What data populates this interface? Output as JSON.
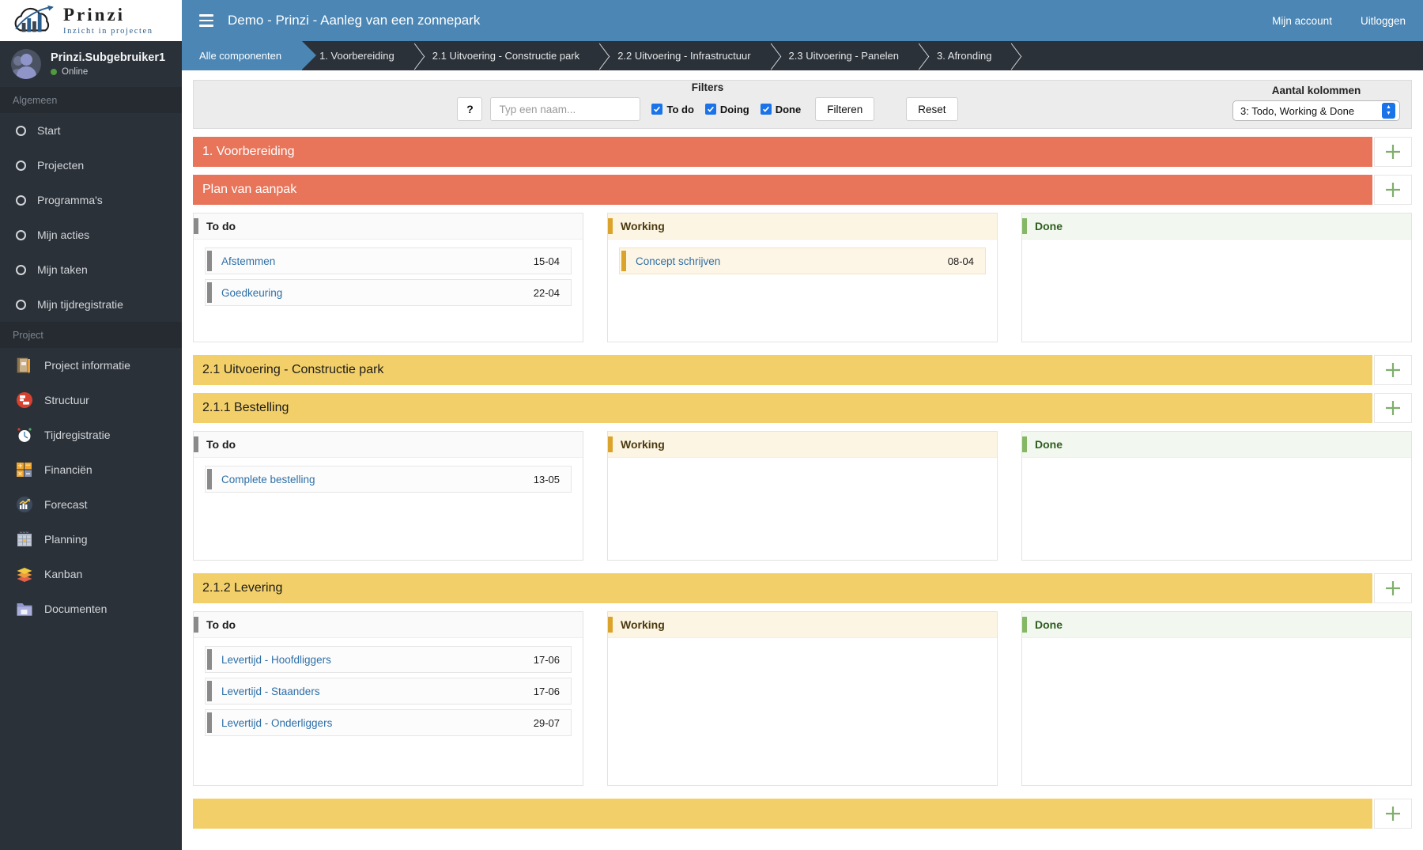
{
  "brand": {
    "title": "Prinzi",
    "subtitle": "Inzicht in projecten",
    "logo_icon": "cloud-chart-logo"
  },
  "user": {
    "name": "Prinzi.Subgebruiker1",
    "status": "Online",
    "avatar_icon": "users-avatar"
  },
  "sidebar": {
    "groups": [
      {
        "label": "Algemeen",
        "items": [
          {
            "label": "Start",
            "icon": "circle-icon"
          },
          {
            "label": "Projecten",
            "icon": "circle-icon"
          },
          {
            "label": "Programma's",
            "icon": "circle-icon"
          },
          {
            "label": "Mijn acties",
            "icon": "circle-icon"
          },
          {
            "label": "Mijn taken",
            "icon": "circle-icon"
          },
          {
            "label": "Mijn tijdregistratie",
            "icon": "circle-icon"
          }
        ]
      },
      {
        "label": "Project",
        "items": [
          {
            "label": "Project informatie",
            "icon": "notebook-icon"
          },
          {
            "label": "Structuur",
            "icon": "sitemap-icon"
          },
          {
            "label": "Tijdregistratie",
            "icon": "stopwatch-icon"
          },
          {
            "label": "Financiën",
            "icon": "calculator-icon"
          },
          {
            "label": "Forecast",
            "icon": "chart-up-icon"
          },
          {
            "label": "Planning",
            "icon": "calendar-icon"
          },
          {
            "label": "Kanban",
            "icon": "layers-icon"
          },
          {
            "label": "Documenten",
            "icon": "folder-icon"
          }
        ]
      }
    ]
  },
  "topbar": {
    "menu_icon": "hamburger-icon",
    "title": "Demo - Prinzi - Aanleg van een zonnepark",
    "account_label": "Mijn account",
    "logout_label": "Uitloggen"
  },
  "breadcrumbs": [
    {
      "label": "Alle componenten",
      "active": true
    },
    {
      "label": "1. Voorbereiding",
      "active": false
    },
    {
      "label": "2.1 Uitvoering - Constructie park",
      "active": false
    },
    {
      "label": "2.2 Uitvoering - Infrastructuur",
      "active": false
    },
    {
      "label": "2.3 Uitvoering - Panelen",
      "active": false
    },
    {
      "label": "3. Afronding",
      "active": false
    }
  ],
  "filters": {
    "title": "Filters",
    "help_label": "?",
    "name_placeholder": "Typ een naam...",
    "name_value": "",
    "checkboxes": [
      {
        "label": "To do",
        "checked": true
      },
      {
        "label": "Doing",
        "checked": true
      },
      {
        "label": "Done",
        "checked": true
      }
    ],
    "filter_button": "Filteren",
    "reset_button": "Reset",
    "columns_label": "Aantal kolommen",
    "columns_value": "3: Todo, Working & Done",
    "columns_options": [
      "3: Todo, Working & Done"
    ]
  },
  "colors": {
    "accent_blue": "#4b86b4",
    "phase_red": "#e8745a",
    "phase_yellow": "#f2cf68",
    "todo_bar": "#8a8a8a",
    "working_bar": "#dba32a",
    "done_bar": "#84b864",
    "plus_green": "#7fae6d",
    "sidebar_bg": "#2b3138",
    "link_blue": "#2e6fa7"
  },
  "board": {
    "add_icon": "plus-icon",
    "sections": [
      {
        "type": "phase",
        "color": "red",
        "title": "1. Voorbereiding"
      },
      {
        "type": "phase",
        "color": "red",
        "title": "Plan van aanpak"
      },
      {
        "type": "columns",
        "columns": [
          {
            "title": "To do",
            "kind": "todo",
            "cards": [
              {
                "title": "Afstemmen",
                "date": "15-04"
              },
              {
                "title": "Goedkeuring",
                "date": "22-04"
              }
            ]
          },
          {
            "title": "Working",
            "kind": "working",
            "cards": [
              {
                "title": "Concept schrijven",
                "date": "08-04"
              }
            ]
          },
          {
            "title": "Done",
            "kind": "done",
            "cards": []
          }
        ]
      },
      {
        "type": "phase",
        "color": "yellow",
        "title": "2.1 Uitvoering - Constructie park"
      },
      {
        "type": "phase",
        "color": "yellow",
        "title": "2.1.1 Bestelling"
      },
      {
        "type": "columns",
        "columns": [
          {
            "title": "To do",
            "kind": "todo",
            "cards": [
              {
                "title": "Complete bestelling",
                "date": "13-05"
              }
            ]
          },
          {
            "title": "Working",
            "kind": "working",
            "cards": []
          },
          {
            "title": "Done",
            "kind": "done",
            "cards": []
          }
        ]
      },
      {
        "type": "phase",
        "color": "yellow",
        "title": "2.1.2 Levering"
      },
      {
        "type": "columns",
        "tall": true,
        "columns": [
          {
            "title": "To do",
            "kind": "todo",
            "cards": [
              {
                "title": "Levertijd - Hoofdliggers",
                "date": "17-06"
              },
              {
                "title": "Levertijd - Staanders",
                "date": "17-06"
              },
              {
                "title": "Levertijd - Onderliggers",
                "date": "29-07"
              }
            ]
          },
          {
            "title": "Working",
            "kind": "working",
            "cards": []
          },
          {
            "title": "Done",
            "kind": "done",
            "cards": []
          }
        ]
      },
      {
        "type": "phase",
        "color": "yellow",
        "title": ""
      }
    ]
  }
}
